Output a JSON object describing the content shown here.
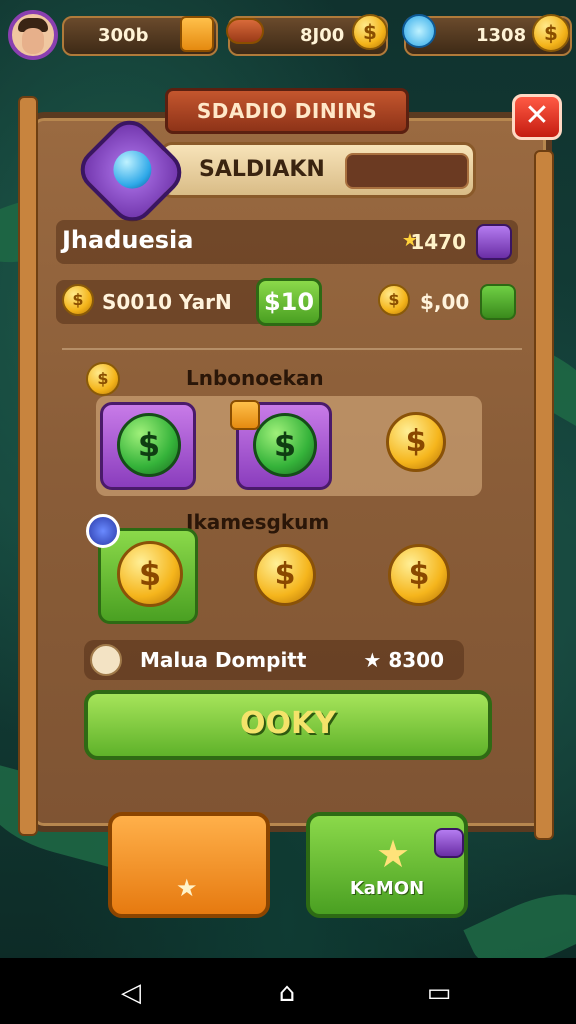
{
  "topbar": {
    "res1": "300b",
    "res2": "8J00",
    "res3": "1308"
  },
  "dialog": {
    "title": "SDADIO DININS",
    "close_symbol": "✕",
    "profile_label": "SALDIAKN"
  },
  "row_player": {
    "name": "Jhaduesia",
    "value": "1470",
    "star": "★"
  },
  "row_balance": {
    "label": "S0010 YarN",
    "button": "$10",
    "right_value": "$,00"
  },
  "section1": {
    "label": "Lnbonoekan"
  },
  "section2": {
    "label": "Ikamesgkum"
  },
  "coin_symbol": "$",
  "info_row": {
    "label": "Malua Dompitt",
    "value": "8300",
    "star": "★"
  },
  "ok_button": "OOKY",
  "bottom": {
    "right_label": "KaMON",
    "left_star": "★"
  },
  "nav": {
    "back": "◁",
    "home": "⌂",
    "recents": "▭"
  },
  "colors": {
    "accent_green": "#5fb22a",
    "accent_orange": "#e67a10",
    "close_red": "#c41c10",
    "purple": "#8a3dbd"
  }
}
